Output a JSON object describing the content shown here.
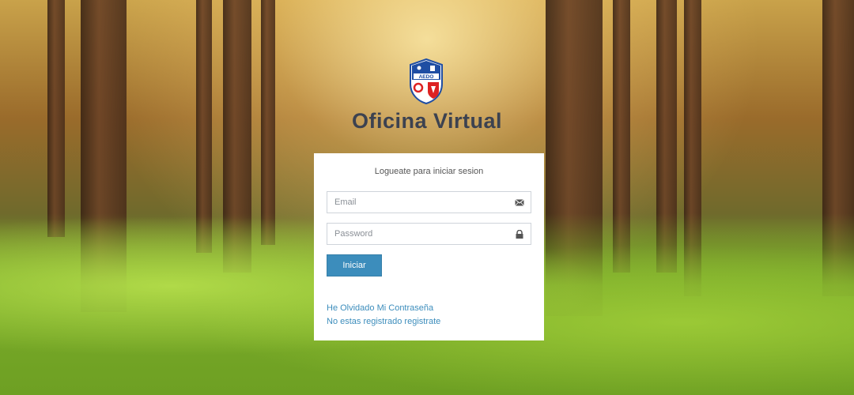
{
  "page": {
    "title": "Oficina Virtual"
  },
  "logo": {
    "text": "AEDO",
    "name": "company-crest"
  },
  "login": {
    "heading": "Logueate para iniciar sesion",
    "email_placeholder": "Email",
    "email_value": "",
    "email_icon": "envelope-icon",
    "password_placeholder": "Password",
    "password_value": "",
    "password_icon": "lock-icon",
    "submit_label": "Iniciar",
    "forgot_link": "He Olvidado Mi Contraseña",
    "register_link": "No estas registrado registrate"
  },
  "colors": {
    "primary": "#3c8dbc",
    "title": "#3c4250",
    "card": "#ffffff"
  }
}
